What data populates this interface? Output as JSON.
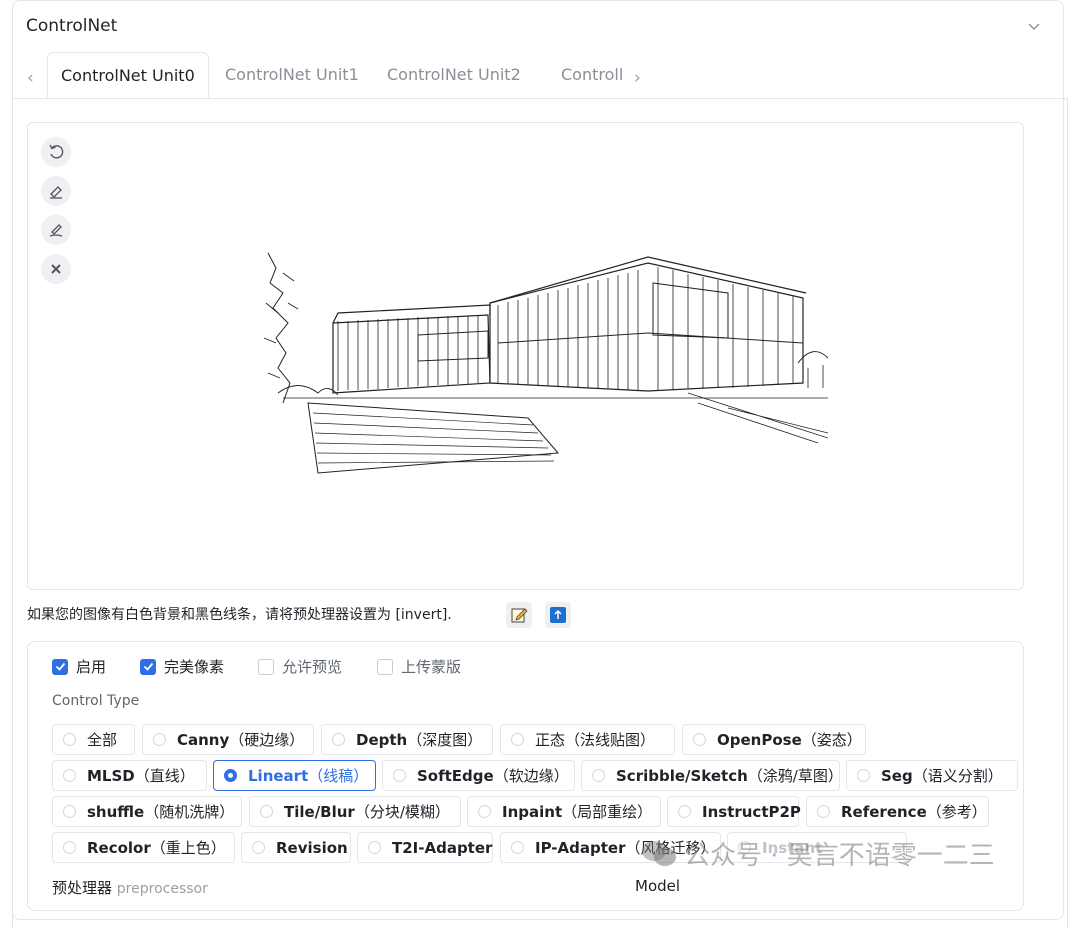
{
  "panel": {
    "title": "ControlNet"
  },
  "tabs": [
    {
      "label": "ControlNet Unit0",
      "active": true
    },
    {
      "label": "ControlNet Unit1"
    },
    {
      "label": "ControlNet Unit2"
    },
    {
      "label": "Controll"
    }
  ],
  "hint": {
    "text": "如果您的图像有白色背景和黑色线条，请将预处理器设置为 [invert]."
  },
  "checkboxes": [
    {
      "label": "启用",
      "checked": true
    },
    {
      "label": "完美像素",
      "checked": true
    },
    {
      "label": "允许预览",
      "checked": false
    },
    {
      "label": "上传蒙版",
      "checked": false
    }
  ],
  "control_type": {
    "label": "Control Type",
    "options": [
      {
        "en": "全部",
        "zh": ""
      },
      {
        "en": "Canny",
        "zh": "（硬边缘）"
      },
      {
        "en": "Depth",
        "zh": "（深度图）"
      },
      {
        "en": "正态",
        "zh": "（法线贴图）"
      },
      {
        "en": "OpenPose",
        "zh": "（姿态）"
      },
      {
        "en": "MLSD",
        "zh": "（直线）"
      },
      {
        "en": "Lineart",
        "zh": "（线稿）",
        "selected": true
      },
      {
        "en": "SoftEdge",
        "zh": "（软边缘）"
      },
      {
        "en": "Scribble/Sketch",
        "zh": "（涂鸦/草图）"
      },
      {
        "en": "Seg",
        "zh": "（语义分割）"
      },
      {
        "en": "shuffle",
        "zh": "（随机洗牌）"
      },
      {
        "en": "Tile/Blur",
        "zh": "（分块/模糊）"
      },
      {
        "en": "Inpaint",
        "zh": "（局部重绘）"
      },
      {
        "en": "InstructP2P",
        "zh": ""
      },
      {
        "en": "Reference",
        "zh": "（参考）"
      },
      {
        "en": "Recolor",
        "zh": "（重上色）"
      },
      {
        "en": "Revision",
        "zh": ""
      },
      {
        "en": "T2I-Adapter",
        "zh": ""
      },
      {
        "en": "IP-Adapter",
        "zh": "（风格迁移）"
      },
      {
        "en": "Instant",
        "zh": ""
      }
    ]
  },
  "preprocessor": {
    "label": "预处理器",
    "sub": "preprocessor"
  },
  "model": {
    "label": "Model"
  },
  "watermark": {
    "text": "公众号 · 吴言不语零一二三"
  }
}
